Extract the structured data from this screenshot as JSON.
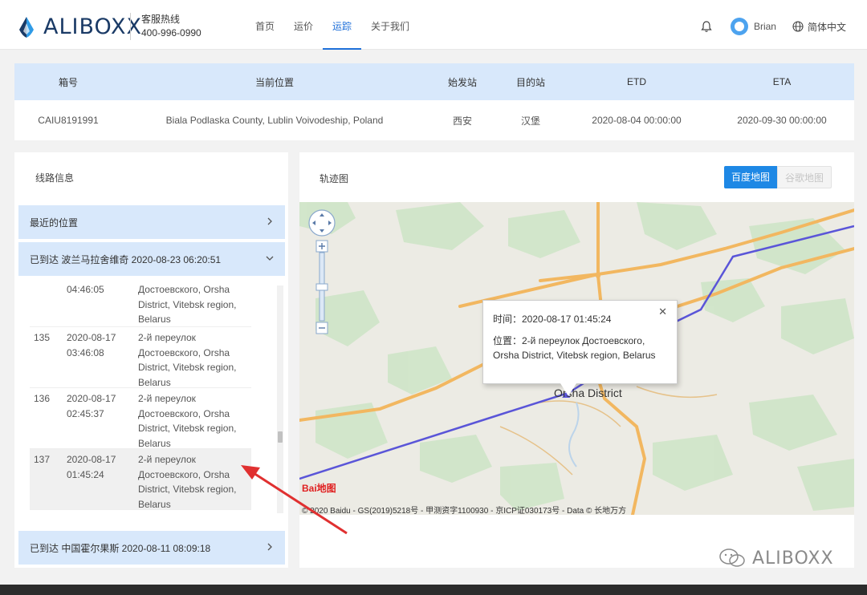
{
  "header": {
    "logo_text": "ALIBOXX",
    "hotline_title": "客服热线",
    "hotline_number": "400-996-0990",
    "nav": [
      "首页",
      "运价",
      "运踪",
      "关于我们"
    ],
    "nav_active": "运踪",
    "user": "Brian",
    "language": "简体中文"
  },
  "info": {
    "headers": [
      "箱号",
      "当前位置",
      "始发站",
      "目的站",
      "ETD",
      "ETA"
    ],
    "row": {
      "box_no": "CAIU8191991",
      "location": "Biala Podlaska County, Lublin Voivodeship, Poland",
      "origin": "西安",
      "destination": "汉堡",
      "etd": "2020-08-04 00:00:00",
      "eta": "2020-09-30 00:00:00"
    }
  },
  "route": {
    "title": "线路信息",
    "recent": "最近的位置",
    "arrived1": "已到达 波兰马拉舍维奇 2020-08-23 06:20:51",
    "arrived2": "已到达 中国霍尔果斯 2020-08-11 08:09:18",
    "rows": [
      {
        "idx": "",
        "time": "04:46:05",
        "loc": "Достоевского, Orsha District, Vitebsk region, Belarus"
      },
      {
        "idx": "135",
        "time": "2020-08-17 03:46:08",
        "loc": "2-й переулок Достоевского, Orsha District, Vitebsk region, Belarus"
      },
      {
        "idx": "136",
        "time": "2020-08-17 02:45:37",
        "loc": "2-й переулок Достоевского, Orsha District, Vitebsk region, Belarus"
      },
      {
        "idx": "137",
        "time": "2020-08-17 01:45:24",
        "loc": "2-й переулок Достоевского, Orsha District, Vitebsk region, Belarus"
      }
    ]
  },
  "map": {
    "title": "轨迹图",
    "toggle_on": "百度地图",
    "toggle_off": "谷歌地图",
    "district": "Orsha District",
    "popup_time": "时间：2020-08-17 01:45:24",
    "popup_loc": "位置：2-й переулок Достоевского, Orsha District, Vitebsk region, Belarus",
    "baidu_logo": "Bai地图",
    "copyright": "© 2020 Baidu - GS(2019)5218号 - 甲测资字1100930 - 京ICP证030173号 - Data © 长地万方"
  },
  "watermark": "ALIBOXX",
  "colors": {
    "accent": "#1e6fd9",
    "route_line": "#5a55d8",
    "road": "#f2b760",
    "head_bg": "#d8e8fb"
  }
}
